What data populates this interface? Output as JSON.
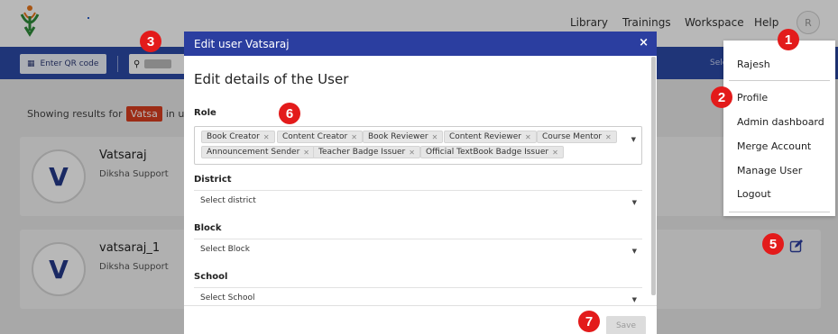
{
  "topbar": {
    "nav": [
      "Library",
      "Trainings",
      "Workspace",
      "Help"
    ],
    "avatar_initial": "R"
  },
  "toolbar": {
    "qr_label": "Enter QR code",
    "select_text": "Sele"
  },
  "results": {
    "prefix": "Showing results for",
    "query": "Vatsa",
    "suffix": "in use"
  },
  "users": [
    {
      "initial": "V",
      "name": "Vatsaraj",
      "org": "Diksha Support"
    },
    {
      "initial": "V",
      "name": "vatsaraj_1",
      "org": "Diksha Support"
    }
  ],
  "profile_menu": {
    "user_name": "Rajesh",
    "items": [
      "Profile",
      "Admin dashboard",
      "Merge Account",
      "Manage User",
      "Logout"
    ]
  },
  "modal": {
    "header": "Edit user Vatsaraj",
    "close": "×",
    "title": "Edit details of the User",
    "role_label": "Role",
    "roles": [
      "Book Creator",
      "Content Creator",
      "Book Reviewer",
      "Content Reviewer",
      "Course Mentor",
      "Announcement Sender",
      "Teacher Badge Issuer",
      "Official TextBook Badge Issuer"
    ],
    "district_label": "District",
    "district_placeholder": "Select district",
    "block_label": "Block",
    "block_placeholder": "Select Block",
    "school_label": "School",
    "school_placeholder": "Select School",
    "save_label": "Save"
  },
  "annotations": [
    "1",
    "2",
    "3",
    "5",
    "6",
    "7"
  ],
  "colors": {
    "header_blue": "#2b3ea0",
    "toolbar_blue": "#2b4aa7",
    "badge_red": "#e31b1b",
    "tag_orange": "#d93d1f"
  }
}
